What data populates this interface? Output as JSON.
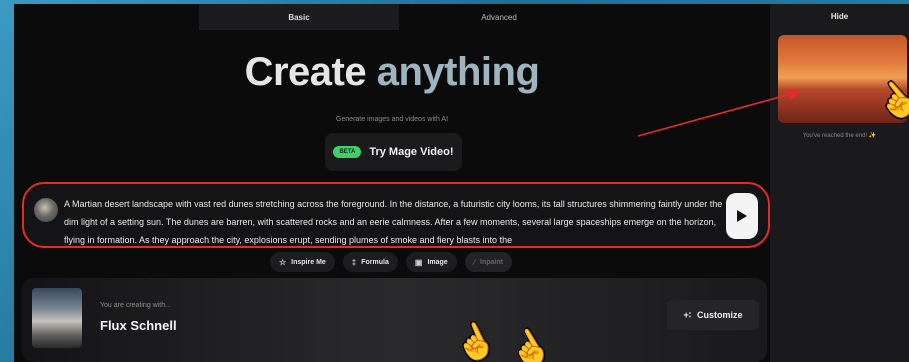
{
  "tabs": [
    {
      "label": "Basic",
      "active": true
    },
    {
      "label": "Advanced",
      "active": false
    }
  ],
  "hero": {
    "title_part1": "Create",
    "title_part2": "anything",
    "subtitle": "Generate images and videos with AI"
  },
  "mage_video": {
    "badge": "BETA",
    "label": "Try Mage Video!"
  },
  "prompt": {
    "text": "A Martian desert landscape with vast red dunes stretching across the foreground. In the distance, a futuristic city looms, its tall structures shimmering faintly under the dim light of a setting sun. The dunes are barren, with scattered rocks and an eerie calmness. After a few moments, several large spaceships emerge on the horizon, flying in formation. As they approach the city, explosions erupt, sending plumes of smoke and fiery blasts into the"
  },
  "chips": [
    {
      "label": "Inspire Me",
      "icon": "lightbulb-icon",
      "glyph": "☆",
      "enabled": true
    },
    {
      "label": "Formula",
      "icon": "flask-icon",
      "glyph": "‡",
      "enabled": true
    },
    {
      "label": "Image",
      "icon": "image-icon",
      "glyph": "▣",
      "enabled": true
    },
    {
      "label": "Inpaint",
      "icon": "brush-icon",
      "glyph": "⁄",
      "enabled": false
    }
  ],
  "model": {
    "caption": "You are creating with...",
    "name": "Flux Schnell",
    "customize_label": "Customize"
  },
  "side": {
    "hide_label": "Hide",
    "end_text": "You've reached the end!",
    "sparkle": "✨"
  },
  "colors": {
    "annotation_red": "#e32b2b",
    "beta_green": "#3fd06a",
    "background_blue": "#2b86ae"
  }
}
